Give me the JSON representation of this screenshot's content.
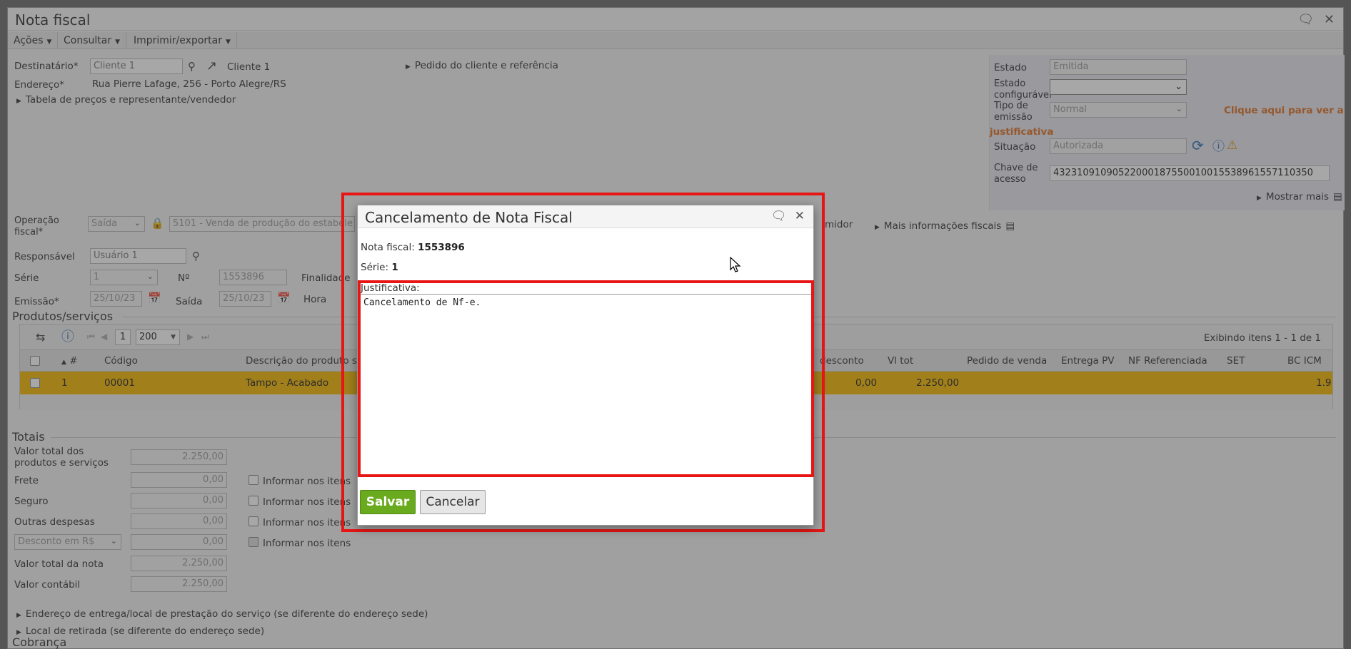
{
  "window": {
    "title": "Nota fiscal"
  },
  "menu": [
    {
      "label": "Ações"
    },
    {
      "label": "Consultar"
    },
    {
      "label": "Imprimir/exportar"
    }
  ],
  "header": {
    "destinatario_label": "Destinatário*",
    "destinatario_value": "Cliente 1",
    "destinatario_link": "Cliente 1",
    "endereco_label": "Endereço*",
    "endereco_value": "Rua Pierre Lafage, 256 - Porto Alegre/RS",
    "tabela_label": "Tabela de preços e representante/vendedor",
    "pedido_label": "Pedido do cliente e referência"
  },
  "right_panel": {
    "estado_label": "Estado",
    "estado_value": "Emitida",
    "estado_conf_label": "Estado configurável",
    "tipo_emissao_label": "Tipo de emissão",
    "tipo_emissao_value": "Normal",
    "clique_aqui": "Clique aqui para ver a",
    "justificativa_link": "justificativa",
    "situacao_label": "Situação",
    "situacao_value": "Autorizada",
    "chave_label": "Chave de acesso",
    "chave_value": "43231091090522000187550010015538961557110350",
    "mostrar_mais": "Mostrar mais"
  },
  "fiscal": {
    "operacao_label": "Operação fiscal*",
    "operacao_value": "Saída",
    "cfop_value": "5101 - Venda de produção do estabele",
    "consumidor": "midor",
    "mais_info": "Mais informações fiscais",
    "responsavel_label": "Responsável",
    "responsavel_value": "Usuário 1",
    "serie_label": "Série",
    "serie_value": "1",
    "numero_label": "Nº",
    "numero_value": "1553896",
    "finalidade_label": "Finalidade",
    "emissao_label": "Emissão*",
    "emissao_value": "25/10/23",
    "saida_label": "Saída",
    "saida_value": "25/10/23",
    "hora_label": "Hora"
  },
  "produtos": {
    "section_title": "Produtos/serviços",
    "page": "1",
    "page_size": "200",
    "exibindo": "Exibindo itens 1 - 1 de 1",
    "columns": [
      "#",
      "Código",
      "Descrição do produto ser",
      "desconto",
      "Vl tot",
      "Pedido de venda",
      "Entrega PV",
      "NF Referenciada",
      "SET",
      "BC ICM"
    ],
    "row": {
      "num": "1",
      "codigo": "00001",
      "descricao": "Tampo - Acabado",
      "desconto": "0,00",
      "vltot": "2.250,00",
      "bc": "1.9"
    }
  },
  "totais": {
    "section_title": "Totais",
    "valor_total_label": "Valor total dos produtos e serviços",
    "valor_total_value": "2.250,00",
    "frete_label": "Frete",
    "frete_value": "0,00",
    "seguro_label": "Seguro",
    "seguro_value": "0,00",
    "outras_label": "Outras despesas",
    "outras_value": "0,00",
    "desconto_select": "Desconto em R$",
    "desconto_value": "0,00",
    "valor_nota_label": "Valor total da nota",
    "valor_nota_value": "2.250,00",
    "valor_contabil_label": "Valor contábil",
    "valor_contabil_value": "2.250,00",
    "informar_label": "Informar nos itens"
  },
  "footer": {
    "endereco_entrega": "Endereço de entrega/local de prestação do serviço (se diferente do endereço sede)",
    "local_retirada": "Local de retirada (se diferente do endereço sede)",
    "cobranca": "Cobrança"
  },
  "dialog": {
    "title": "Cancelamento de Nota Fiscal",
    "nf_label": "Nota fiscal:",
    "nf_value": "1553896",
    "serie_label": "Série:",
    "serie_value": "1",
    "justificativa_label": "Justificativa:",
    "justificativa_value": "Cancelamento de Nf-e.",
    "save_label": "Salvar",
    "cancel_label": "Cancelar"
  },
  "colors": {
    "accent": "#6aaa1e",
    "highlight": "#e81515",
    "row": "#f5b700",
    "link": "#e07020"
  }
}
